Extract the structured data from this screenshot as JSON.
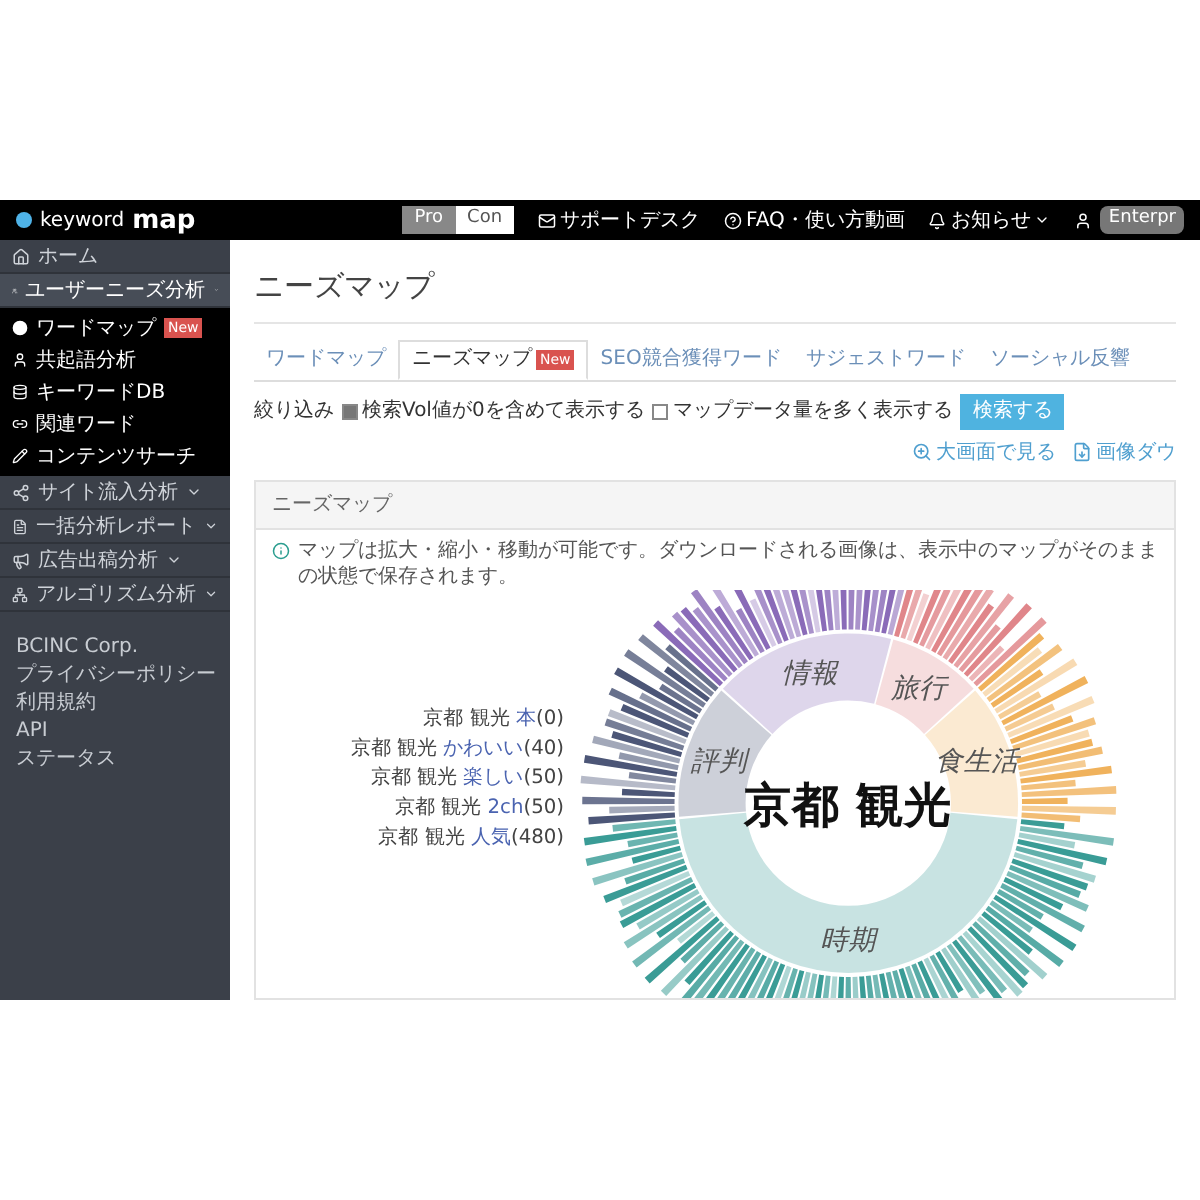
{
  "header": {
    "logo": {
      "prefix": "keyword",
      "suffix": "map"
    },
    "plan_toggle": [
      {
        "label": "Pro",
        "selected": true
      },
      {
        "label": "Con",
        "selected": false
      }
    ],
    "links": [
      {
        "label": "サポートデスク",
        "caret": false
      },
      {
        "label": "FAQ・使い方動画",
        "caret": false
      },
      {
        "label": "お知らせ",
        "caret": true
      }
    ],
    "user_badge": "Enterpr"
  },
  "sidebar": {
    "items": [
      {
        "label": "ホーム",
        "kind": "link"
      },
      {
        "label": "ユーザーニーズ分析",
        "kind": "group",
        "expanded": true,
        "children": [
          {
            "label": "ワードマップ",
            "badge": "New"
          },
          {
            "label": "共起語分析"
          },
          {
            "label": "キーワードDB"
          },
          {
            "label": "関連ワード"
          },
          {
            "label": "コンテンツサーチ"
          }
        ]
      },
      {
        "label": "サイト流入分析",
        "kind": "group",
        "expanded": false
      },
      {
        "label": "一括分析レポート",
        "kind": "group",
        "expanded": false
      },
      {
        "label": "広告出稿分析",
        "kind": "group",
        "expanded": false
      },
      {
        "label": "アルゴリズム分析",
        "kind": "group",
        "expanded": false
      }
    ],
    "footer_links": [
      "BCINC Corp.",
      "プライバシーポリシー",
      "利用規約",
      "API",
      "ステータス"
    ]
  },
  "page": {
    "title": "ニーズマップ",
    "tabs": [
      {
        "label": "ワードマップ",
        "selected": false
      },
      {
        "label": "ニーズマップ",
        "badge": "New",
        "selected": true
      },
      {
        "label": "SEO競合獲得ワード",
        "selected": false
      },
      {
        "label": "サジェストワード",
        "selected": false
      },
      {
        "label": "ソーシャル反響",
        "selected": false
      }
    ],
    "filter": {
      "label": "絞り込み",
      "options": [
        {
          "label": "検索Vol値が0を含めて表示する",
          "checked": true
        },
        {
          "label": "マップデータ量を多く表示する",
          "checked": false
        }
      ],
      "button": "検索する"
    },
    "actions": [
      "大画面で見る",
      "画像ダウ"
    ],
    "panel": {
      "title": "ニーズマップ",
      "info": "マップは拡大・縮小・移動が可能です。ダウンロードされる画像は、表示中のマップがそのままの状態で保存されます。",
      "center": "京都 観光",
      "segments": [
        {
          "label": "時期",
          "color": "#3a9c96"
        },
        {
          "label": "評判",
          "color": "#4c5677"
        },
        {
          "label": "情報",
          "color": "#8a6bb8"
        },
        {
          "label": "旅行",
          "color": "#e0868a"
        },
        {
          "label": "食生活",
          "color": "#f0b25c"
        }
      ],
      "outer_labels": [
        {
          "prefix": "京都 観光",
          "term": "本",
          "count": "(0)"
        },
        {
          "prefix": "京都 観光",
          "term": "かわいい",
          "count": "(40)"
        },
        {
          "prefix": "京都 観光",
          "term": "楽しい",
          "count": "(50)"
        },
        {
          "prefix": "京都 観光",
          "term": "2ch",
          "count": "(50)"
        },
        {
          "prefix": "京都 観光",
          "term": "人気",
          "count": "(480)"
        }
      ]
    }
  }
}
